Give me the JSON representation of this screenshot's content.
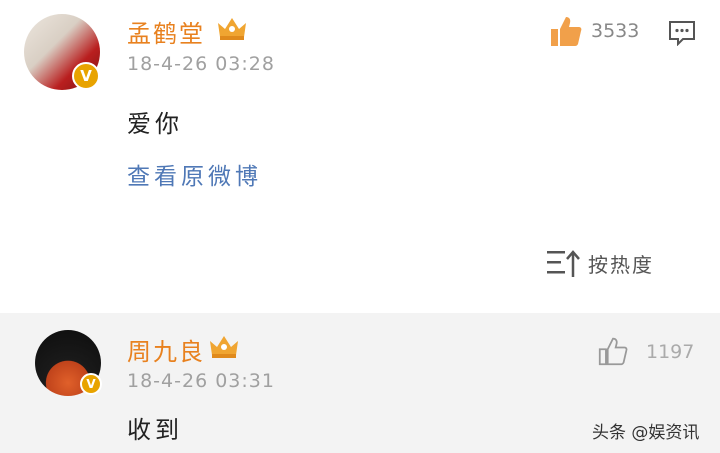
{
  "post": {
    "author": "孟鹤堂",
    "timestamp": "18-4-26 03:28",
    "text": "爱你",
    "view_original": "查看原微博",
    "like_count": "3533",
    "sort_label": "按热度"
  },
  "reply": {
    "author": "周九良",
    "timestamp": "18-4-26 03:31",
    "text": "收到",
    "like_count": "1197"
  },
  "watermark": "头条 @娱资讯",
  "colors": {
    "username": "#e8811f",
    "link": "#4f78b6",
    "crown": "#f0a531",
    "verified": "#e8a300"
  }
}
